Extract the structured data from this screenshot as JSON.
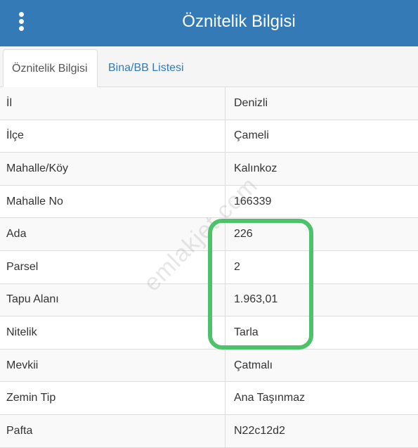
{
  "header": {
    "title": "Öznitelik Bilgisi",
    "menu_icon": "vertical-dots-icon",
    "background": "#337ab7"
  },
  "tabs": [
    {
      "label": "Öznitelik Bilgisi",
      "active": true
    },
    {
      "label": "Bina/BB Listesi",
      "active": false
    }
  ],
  "rows": [
    {
      "key": "İl",
      "value": "Denizli"
    },
    {
      "key": "İlçe",
      "value": "Çameli"
    },
    {
      "key": "Mahalle/Köy",
      "value": "Kalınkoz"
    },
    {
      "key": "Mahalle No",
      "value": "166339"
    },
    {
      "key": "Ada",
      "value": "226"
    },
    {
      "key": "Parsel",
      "value": "2"
    },
    {
      "key": "Tapu Alanı",
      "value": "1.963,01"
    },
    {
      "key": "Nitelik",
      "value": "Tarla"
    },
    {
      "key": "Mevkii",
      "value": "Çatmalı"
    },
    {
      "key": "Zemin Tip",
      "value": "Ana Taşınmaz"
    },
    {
      "key": "Pafta",
      "value": "N22c12d2"
    }
  ],
  "highlight_color": "#4cc26a",
  "watermark": "emlakjet.com"
}
